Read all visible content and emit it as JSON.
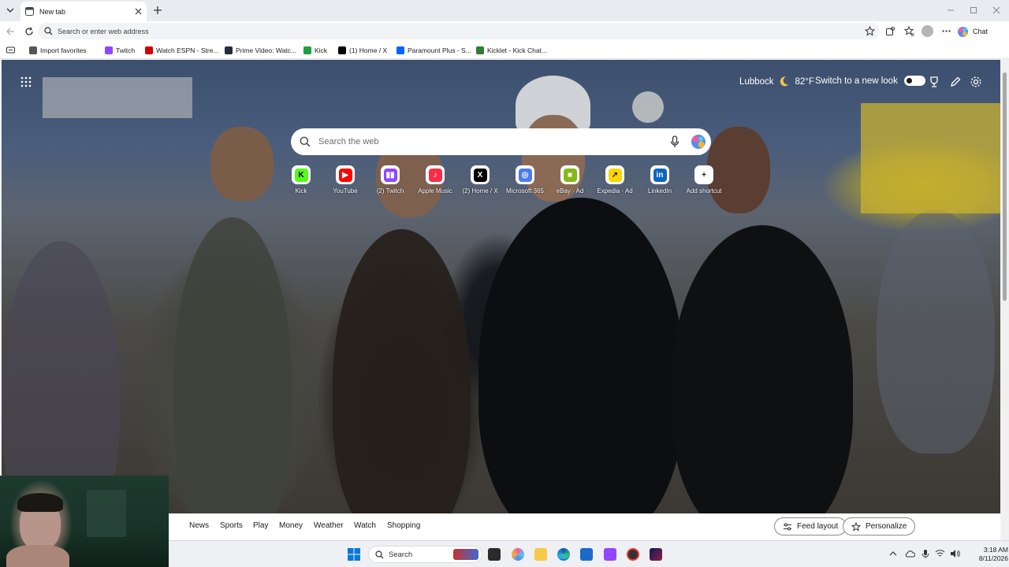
{
  "browser": {
    "tab": {
      "title": "New tab"
    },
    "address_bar": {
      "placeholder": "Search or enter web address"
    },
    "chat_label": "Chat"
  },
  "favorites": [
    {
      "label": "Import favorites",
      "icon": "import-icon",
      "color": "#555555"
    },
    {
      "label": "Twitch",
      "icon": "twitch-icon",
      "color": "#9146ff"
    },
    {
      "label": "Watch ESPN - Stre...",
      "icon": "espn-icon",
      "color": "#d00000"
    },
    {
      "label": "Prime Video: Watc...",
      "icon": "amazon-icon",
      "color": "#232f3e"
    },
    {
      "label": "Kick",
      "icon": "kick-icon",
      "color": "#1e9e3e"
    },
    {
      "label": "(1) Home / X",
      "icon": "x-icon",
      "color": "#000000"
    },
    {
      "label": "Paramount Plus - S...",
      "icon": "paramount-icon",
      "color": "#0064ff"
    },
    {
      "label": "Kicklet - Kick Chat...",
      "icon": "kicklet-icon",
      "color": "#2e7d32"
    }
  ],
  "newtab": {
    "weather": {
      "city": "Lubbock",
      "temp": "82°F",
      "icon": "moon-icon"
    },
    "new_look_label": "Switch to a new look",
    "new_look_enabled": false,
    "search_placeholder": "Search the web",
    "shortcuts": [
      {
        "label": "Kick",
        "icon": "kick-icon",
        "color": "#53fc18",
        "text_color": "#000000",
        "glyph": "K"
      },
      {
        "label": "YouTube",
        "icon": "youtube-icon",
        "color": "#ff0000",
        "text_color": "#ffffff",
        "glyph": "▶"
      },
      {
        "label": "(2) Twitch",
        "icon": "twitch-icon",
        "color": "#9146ff",
        "text_color": "#ffffff",
        "glyph": "▮▮"
      },
      {
        "label": "Apple Music",
        "icon": "apple-music-icon",
        "color": "#fa2d48",
        "text_color": "#ffffff",
        "glyph": "♪"
      },
      {
        "label": "(2) Home / X",
        "icon": "x-icon",
        "color": "#000000",
        "text_color": "#ffffff",
        "glyph": "X"
      },
      {
        "label": "Microsoft 365",
        "icon": "microsoft365-icon",
        "color": "#4b7bec",
        "text_color": "#ffffff",
        "glyph": "◎"
      },
      {
        "label": "eBay · Ad",
        "icon": "ebay-icon",
        "color": "#86b817",
        "text_color": "#ffffff",
        "glyph": "■"
      },
      {
        "label": "Expedia · Ad",
        "icon": "expedia-icon",
        "color": "#ffd500",
        "text_color": "#1b1b1b",
        "glyph": "↗"
      },
      {
        "label": "LinkedIn",
        "icon": "linkedin-icon",
        "color": "#0a66c2",
        "text_color": "#ffffff",
        "glyph": "in"
      },
      {
        "label": "Add shortcut",
        "icon": "plus-icon",
        "color": "#ffffff",
        "text_color": "#1b1b1b",
        "glyph": "+"
      }
    ]
  },
  "feed": {
    "tabs": [
      "News",
      "Sports",
      "Play",
      "Money",
      "Weather",
      "Watch",
      "Shopping"
    ],
    "feed_layout_label": "Feed layout",
    "personalize_label": "Personalize"
  },
  "taskbar": {
    "search_label": "Search",
    "time": "3:18 AM",
    "date": "8/11/2026"
  }
}
